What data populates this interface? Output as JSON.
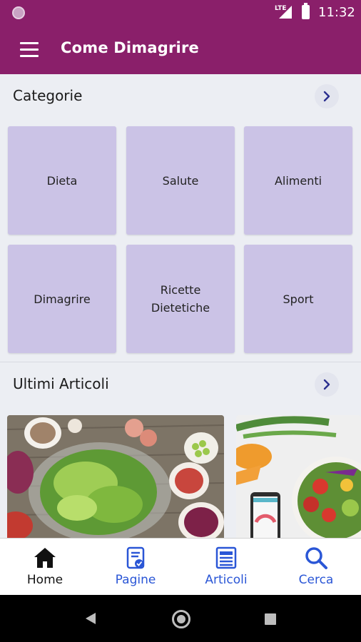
{
  "status_bar": {
    "time": "11:32",
    "network": "LTE",
    "icons": [
      "app-notification-icon",
      "signal-icon",
      "battery-icon"
    ]
  },
  "app_bar": {
    "title": "Come Dimagrire",
    "menu_icon": "hamburger-menu-icon"
  },
  "categories_section": {
    "title": "Categorie",
    "more_icon": "chevron-right-icon",
    "items": [
      {
        "label": "Dieta"
      },
      {
        "label": "Salute"
      },
      {
        "label": "Alimenti"
      },
      {
        "label": "Dimagrire"
      },
      {
        "label": "Ricette Dietetiche"
      },
      {
        "label": "Sport"
      }
    ]
  },
  "articles_section": {
    "title": "Ultimi Articoli",
    "more_icon": "chevron-right-icon",
    "cards": [
      {
        "image": "salad-ingredients-photo"
      },
      {
        "image": "diet-salad-and-phone-photo"
      }
    ]
  },
  "bottom_nav": {
    "items": [
      {
        "label": "Home",
        "icon": "home-icon",
        "active": true
      },
      {
        "label": "Pagine",
        "icon": "pages-icon",
        "active": false
      },
      {
        "label": "Articoli",
        "icon": "articles-icon",
        "active": false
      },
      {
        "label": "Cerca",
        "icon": "search-icon",
        "active": false
      }
    ]
  },
  "system_nav": {
    "icons": [
      "back-icon",
      "home-circle-icon",
      "recents-icon"
    ]
  },
  "colors": {
    "primary": "#8a1f6a",
    "tile": "#cbc3e6",
    "nav_active": "#111111",
    "nav_inactive": "#2a56d6",
    "background": "#eceef3"
  }
}
